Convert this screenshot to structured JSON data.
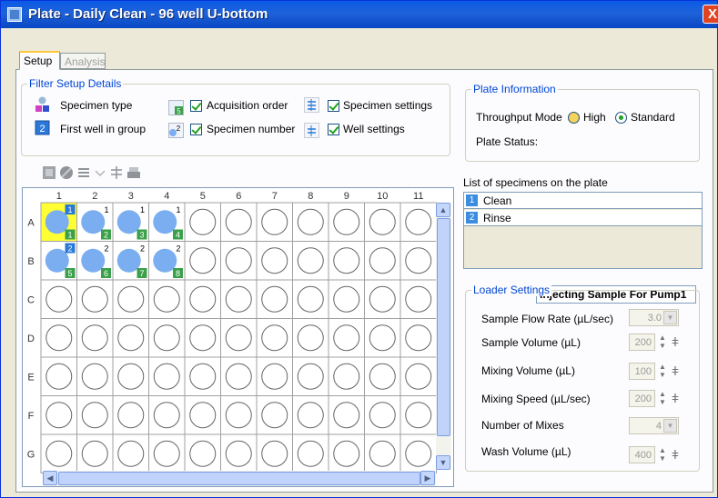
{
  "window": {
    "title": "Plate - Daily Clean - 96 well U-bottom",
    "close_glyph": "X"
  },
  "tabs": [
    {
      "label": "Setup",
      "active": true
    },
    {
      "label": "Analysis",
      "active": false
    }
  ],
  "filter": {
    "legend": "Filter Setup Details",
    "specimen_type": "Specimen type",
    "first_well": "First well in group",
    "acquisition_order": "Acquisition order",
    "specimen_number": "Specimen number",
    "specimen_settings": "Specimen settings",
    "well_settings": "Well settings",
    "acq_icon_num": "5",
    "spec_icon_num": "2",
    "first_icon_num": "2"
  },
  "plate_info": {
    "legend": "Plate Information",
    "throughput_label": "Throughput Mode",
    "high": "High",
    "standard": "Standard",
    "selected": "Standard",
    "status_label": "Plate Status:",
    "status_value": "Injecting Sample For Pump1"
  },
  "specimens": {
    "label": "List of specimens on the plate",
    "items": [
      {
        "num": "1",
        "name": "Clean"
      },
      {
        "num": "2",
        "name": "Rinse"
      }
    ]
  },
  "loader": {
    "legend": "Loader Settings",
    "flow_rate_label": "Sample Flow Rate (µL/sec)",
    "flow_rate_value": "3.0",
    "sample_volume_label": "Sample Volume (µL)",
    "sample_volume_value": "200",
    "mixing_volume_label": "Mixing Volume (µL)",
    "mixing_volume_value": "100",
    "mixing_speed_label": "Mixing Speed (µL/sec)",
    "mixing_speed_value": "200",
    "num_mixes_label": "Number of Mixes",
    "num_mixes_value": "4",
    "wash_volume_label": "Wash Volume (µL)",
    "wash_volume_value": "400"
  },
  "grid": {
    "columns": [
      "1",
      "2",
      "3",
      "4",
      "5",
      "6",
      "7",
      "8",
      "9",
      "10",
      "11"
    ],
    "rows": [
      "A",
      "B",
      "C",
      "D",
      "E",
      "F",
      "G"
    ],
    "filled_wells": [
      {
        "row": "A",
        "col": 1,
        "specimen": "1",
        "order": "1",
        "selected": true
      },
      {
        "row": "A",
        "col": 2,
        "specimen": "1",
        "order": "2"
      },
      {
        "row": "A",
        "col": 3,
        "specimen": "1",
        "order": "3"
      },
      {
        "row": "A",
        "col": 4,
        "specimen": "1",
        "order": "4"
      },
      {
        "row": "B",
        "col": 1,
        "specimen": "2",
        "order": "5"
      },
      {
        "row": "B",
        "col": 2,
        "specimen": "2",
        "order": "6"
      },
      {
        "row": "B",
        "col": 3,
        "specimen": "2",
        "order": "7"
      },
      {
        "row": "B",
        "col": 4,
        "specimen": "2",
        "order": "8"
      }
    ]
  },
  "colors": {
    "well_fill": "#7aaef0",
    "selected_well_bg": "#ffff33",
    "order_badge": "#3aa04a",
    "group_badge": "#2a78d8",
    "legend_text": "#0046d5"
  }
}
